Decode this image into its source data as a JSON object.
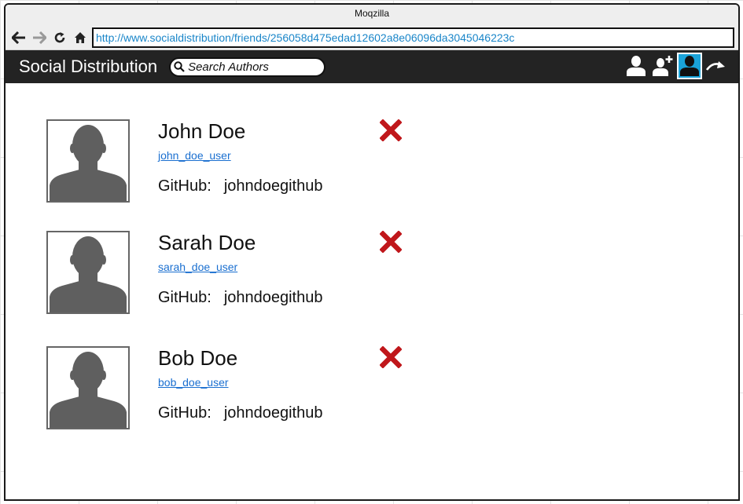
{
  "browser": {
    "title": "Moqzilla",
    "url": "http://www.socialdistribution/friends/256058d475edad12602a8e06096da3045046223c"
  },
  "app": {
    "brand": "Social Distribution",
    "search_placeholder": "Search Authors"
  },
  "friends": [
    {
      "name": "John Doe",
      "username": "john_doe_user",
      "github_label": "GitHub:",
      "github": "johndoegithub"
    },
    {
      "name": "Sarah Doe",
      "username": "sarah_doe_user",
      "github_label": "GitHub:",
      "github": "johndoegithub"
    },
    {
      "name": "Bob Doe",
      "username": "bob_doe_user",
      "github_label": "GitHub:",
      "github": "johndoegithub"
    }
  ],
  "colors": {
    "appbar": "#232323",
    "active_icon": "#1aa3d9",
    "remove": "#c0171b",
    "link": "#1a6fd0",
    "avatar_silhouette": "#5f5f5f"
  }
}
